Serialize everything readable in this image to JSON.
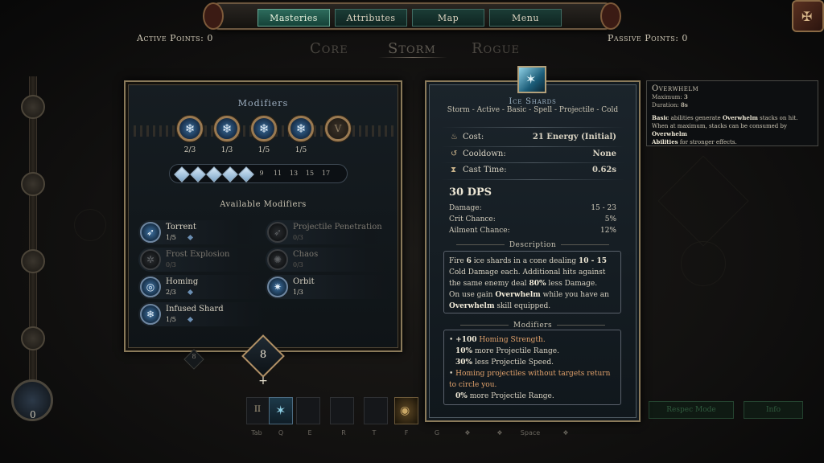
{
  "nav": {
    "items": [
      {
        "label": "Masteries",
        "active": true
      },
      {
        "label": "Attributes",
        "active": false
      },
      {
        "label": "Map",
        "active": false
      },
      {
        "label": "Menu",
        "active": false
      }
    ]
  },
  "points": {
    "active_label": "Active Points: 0",
    "passive_label": "Passive Points: 0"
  },
  "mastery_tabs": [
    "Core",
    "Storm",
    "Rogue"
  ],
  "active_mastery_tab": "Storm",
  "modifiers_panel": {
    "title": "Modifiers",
    "slots": [
      {
        "icon": "snowflake-icon",
        "count": "2/3"
      },
      {
        "icon": "snowflake-icon",
        "count": "1/3"
      },
      {
        "icon": "snowflake-icon",
        "count": "1/5"
      },
      {
        "icon": "snowflake-icon",
        "count": "1/5"
      },
      {
        "icon": "locked-icon",
        "glyph": "V",
        "count": ""
      }
    ],
    "level_track": {
      "filled_diamonds": 5,
      "levels": [
        "9",
        "11",
        "13",
        "15",
        "17"
      ]
    },
    "available_title": "Available Modifiers",
    "available": [
      {
        "name": "Torrent",
        "count": "1/5",
        "enabled": true,
        "pip": true
      },
      {
        "name": "Projectile Penetration",
        "count": "0/3",
        "enabled": false,
        "pip": false
      },
      {
        "name": "Frost Explosion",
        "count": "0/3",
        "enabled": false,
        "pip": false
      },
      {
        "name": "Chaos",
        "count": "0/3",
        "enabled": false,
        "pip": false
      },
      {
        "name": "Homing",
        "count": "2/3",
        "enabled": true,
        "pip": true
      },
      {
        "name": "Orbit",
        "count": "1/3",
        "enabled": true,
        "pip": false
      },
      {
        "name": "Infused Shard",
        "count": "1/5",
        "enabled": true,
        "pip": true
      }
    ]
  },
  "skill_points": {
    "value": "8",
    "plus": "+",
    "small_badge": "8"
  },
  "left_pillar": {
    "orb_value": "0"
  },
  "hotbar": {
    "keys": [
      "Tab",
      "Q",
      "E",
      "R",
      "T",
      "F",
      "G",
      "",
      "",
      "Space",
      "",
      ""
    ],
    "tab_glyph": "II"
  },
  "skill": {
    "name": "Ice Shards",
    "tags": "Storm - Active - Basic - Spell - Projectile - Cold",
    "stats": [
      {
        "icon": "energy-icon",
        "label": "Cost:",
        "value": "21 Energy (Initial)"
      },
      {
        "icon": "cooldown-icon",
        "label": "Cooldown:",
        "value": "None"
      },
      {
        "icon": "hourglass-icon",
        "label": "Cast Time:",
        "value": "0.62s"
      }
    ],
    "dps": "30 DPS",
    "damage": [
      {
        "label": "Damage:",
        "value": "15 - 23"
      },
      {
        "label": "Crit Chance:",
        "value": "5%"
      },
      {
        "label": "Ailment Chance:",
        "value": "12%"
      }
    ],
    "description_title": "Description",
    "description": {
      "p1": "Fire ",
      "n1": "6",
      "p2": " ice shards in a cone dealing ",
      "n2": "10 - 15",
      "p3": " Cold Damage each. Additional hits against the same enemy deal ",
      "n3": "80%",
      "p4": " less Damage.",
      "p5": "On use gain ",
      "n4": "Overwhelm",
      "p6": " while you have an ",
      "n5": "Overwhelm",
      "p7": " skill equipped."
    },
    "modifiers_title": "Modifiers",
    "modifiers": {
      "l1a": "+100",
      "l1b": " Homing Strength.",
      "l2a": "10%",
      "l2b": " more Projectile Range.",
      "l3a": "30%",
      "l3b": " less Projectile Speed.",
      "l4": "Homing projectiles without targets return to circle you.",
      "l5a": "0%",
      "l5b": " more Projectile Range."
    }
  },
  "keyword": {
    "title": "Overwhelm",
    "max_label": "Maximum: ",
    "max_value": "3",
    "dur_label": "Duration: ",
    "dur_value": "8s",
    "b1": "Basic",
    "t1": " abilities generate ",
    "b2": "Overwhelm",
    "t2": " stacks on hit.",
    "t3": "When at maximum, stacks can be consumed by ",
    "b3": "Overwhelm",
    "t4": " ",
    "b4": "Abilities",
    "t5": " for stronger effects."
  },
  "bottom_buttons": [
    "Respec Mode",
    "Info"
  ],
  "colors": {
    "accent_gold": "#8a7a5a",
    "active_tab": "#2d6b5c",
    "highlight_orange": "#e1a16b",
    "ice_blue": "#3a6c9a"
  }
}
